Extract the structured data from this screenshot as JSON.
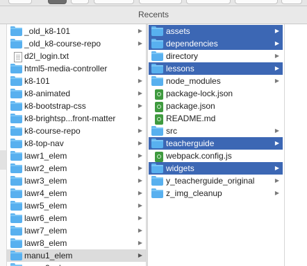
{
  "window": {
    "title": "Recents"
  },
  "column1": {
    "items": [
      {
        "label": "_old_k8-101",
        "kind": "folder",
        "chevron": true
      },
      {
        "label": "_old_k8-course-repo",
        "kind": "folder",
        "chevron": true
      },
      {
        "label": "d2l_login.txt",
        "kind": "text-file",
        "chevron": false
      },
      {
        "label": "html5-media-controller",
        "kind": "folder",
        "chevron": true
      },
      {
        "label": "k8-101",
        "kind": "folder",
        "chevron": true
      },
      {
        "label": "k8-animated",
        "kind": "folder",
        "chevron": true
      },
      {
        "label": "k8-bootstrap-css",
        "kind": "folder",
        "chevron": true
      },
      {
        "label": "k8-brightsp...front-matter",
        "kind": "folder",
        "chevron": true
      },
      {
        "label": "k8-course-repo",
        "kind": "folder",
        "chevron": true
      },
      {
        "label": "k8-top-nav",
        "kind": "folder",
        "chevron": true
      },
      {
        "label": "lawr1_elem",
        "kind": "folder",
        "chevron": true
      },
      {
        "label": "lawr2_elem",
        "kind": "folder",
        "chevron": true
      },
      {
        "label": "lawr3_elem",
        "kind": "folder",
        "chevron": true
      },
      {
        "label": "lawr4_elem",
        "kind": "folder",
        "chevron": true
      },
      {
        "label": "lawr5_elem",
        "kind": "folder",
        "chevron": true
      },
      {
        "label": "lawr6_elem",
        "kind": "folder",
        "chevron": true
      },
      {
        "label": "lawr7_elem",
        "kind": "folder",
        "chevron": true
      },
      {
        "label": "lawr8_elem",
        "kind": "folder",
        "chevron": true
      },
      {
        "label": "manu1_elem",
        "kind": "folder",
        "chevron": true,
        "state": "gray"
      },
      {
        "label": "manu2_elem",
        "kind": "folder",
        "chevron": true
      }
    ]
  },
  "column2": {
    "items": [
      {
        "label": "assets",
        "kind": "folder",
        "chevron": true,
        "state": "selected"
      },
      {
        "label": "dependencies",
        "kind": "folder",
        "chevron": true,
        "state": "selected"
      },
      {
        "label": "directory",
        "kind": "folder",
        "chevron": true
      },
      {
        "label": "lessons",
        "kind": "folder",
        "chevron": true,
        "state": "selected"
      },
      {
        "label": "node_modules",
        "kind": "folder",
        "chevron": true
      },
      {
        "label": "package-lock.json",
        "kind": "json-file",
        "chevron": false
      },
      {
        "label": "package.json",
        "kind": "json-file",
        "chevron": false
      },
      {
        "label": "README.md",
        "kind": "json-file",
        "chevron": false
      },
      {
        "label": "src",
        "kind": "folder",
        "chevron": true
      },
      {
        "label": "teacherguide",
        "kind": "folder",
        "chevron": true,
        "state": "selected"
      },
      {
        "label": "webpack.config.js",
        "kind": "json-file",
        "chevron": false
      },
      {
        "label": "widgets",
        "kind": "folder",
        "chevron": true,
        "state": "selected"
      },
      {
        "label": "y_teacherguide_original",
        "kind": "folder",
        "chevron": true
      },
      {
        "label": "z_img_cleanup",
        "kind": "folder",
        "chevron": true
      }
    ]
  },
  "icons": {
    "folder": "folder-icon",
    "text-file": "text-file-icon",
    "json-file": "js-file-icon",
    "chevron": "chevron-right-icon"
  },
  "colors": {
    "selection": "#3c67b4",
    "folder": "#58b0ef",
    "script_file": "#3f9a3f",
    "inactive_selection": "#dcdcdc"
  }
}
